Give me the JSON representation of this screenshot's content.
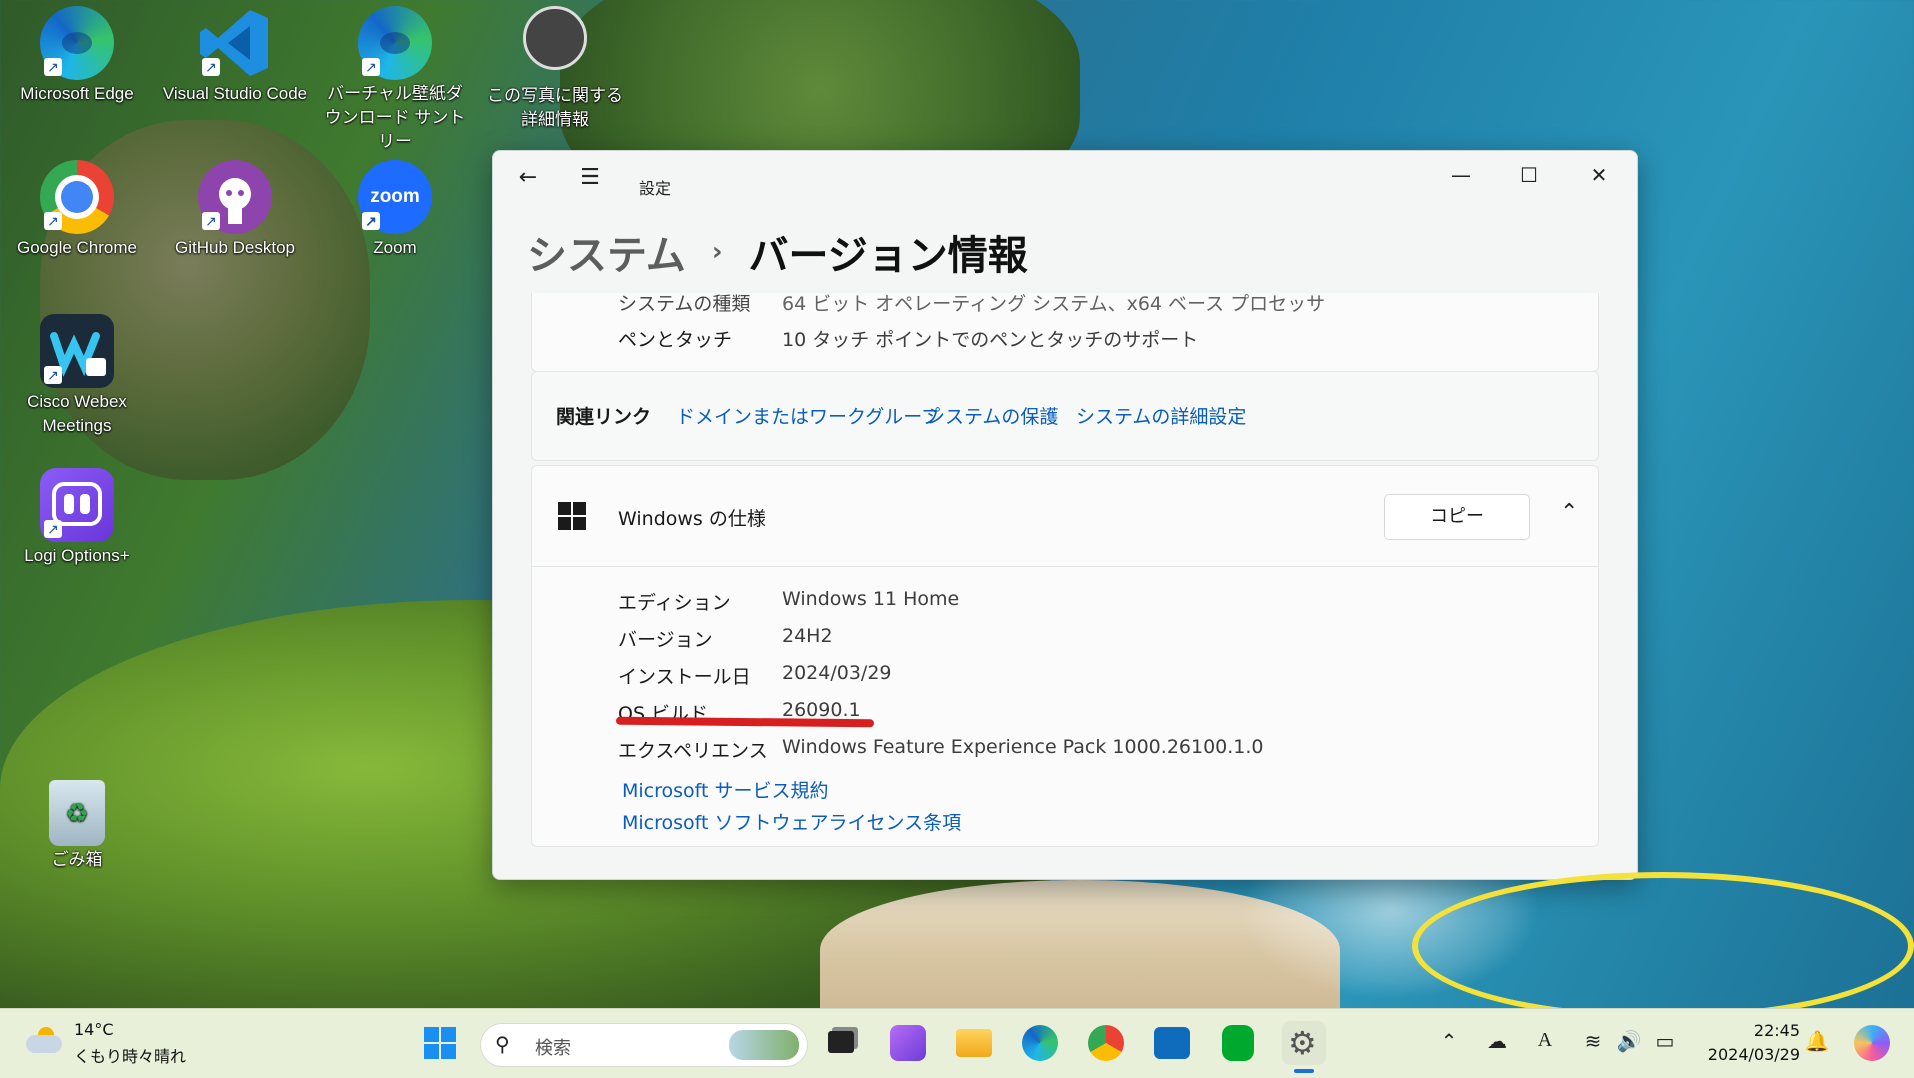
{
  "desktop": {
    "icons": [
      {
        "label": "Microsoft Edge"
      },
      {
        "label": "Visual Studio Code"
      },
      {
        "label": "バーチャル壁紙ダウンロード サントリー"
      },
      {
        "label": "この写真に関する詳細情報"
      },
      {
        "label": "Google Chrome"
      },
      {
        "label": "GitHub Desktop"
      },
      {
        "label": "Zoom",
        "logo_text": "zoom"
      },
      {
        "label": "Cisco Webex Meetings"
      },
      {
        "label": "Logi Options+"
      },
      {
        "label": "ごみ箱"
      }
    ]
  },
  "settings": {
    "app_title": "設定",
    "breadcrumb": {
      "parent": "システム",
      "current": "バージョン情報"
    },
    "device_specs": [
      {
        "label": "システムの種類",
        "value": "64 ビット オペレーティング システム、x64 ベース プロセッサ"
      },
      {
        "label": "ペンとタッチ",
        "value": "10 タッチ ポイントでのペンとタッチのサポート"
      }
    ],
    "related_links": {
      "title": "関連リンク",
      "links": [
        "ドメインまたはワークグループ",
        "システムの保護",
        "システムの詳細設定"
      ]
    },
    "windows_spec": {
      "title": "Windows の仕様",
      "copy_label": "コピー",
      "rows": [
        {
          "label": "エディション",
          "value": "Windows 11 Home"
        },
        {
          "label": "バージョン",
          "value": "24H2"
        },
        {
          "label": "インストール日",
          "value": "2024/03/29"
        },
        {
          "label": "OS ビルド",
          "value": "26090.1"
        },
        {
          "label": "エクスペリエンス",
          "value": "Windows Feature Experience Pack 1000.26100.1.0"
        }
      ],
      "links": [
        "Microsoft サービス規約",
        "Microsoft ソフトウェアライセンス条項"
      ]
    }
  },
  "taskbar": {
    "weather": {
      "temp": "14°C",
      "desc": "くもり時々晴れ"
    },
    "search_placeholder": "検索",
    "clock": {
      "time": "22:45",
      "date": "2024/03/29"
    },
    "ime": "A"
  },
  "colors": {
    "link": "#0a5dbb",
    "annotation_red": "#d81f1f",
    "annotation_yellow": "#f4e23a"
  }
}
